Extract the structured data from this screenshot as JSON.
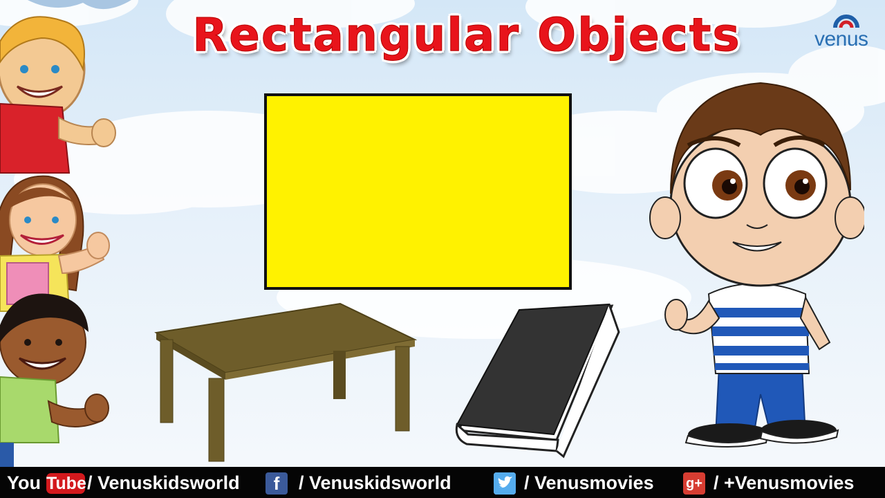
{
  "title": "Rectangular Objects",
  "brand": {
    "name": "venus"
  },
  "footer": {
    "youtube_you": "You",
    "youtube_tube": "Tube",
    "youtube_handle": "/ Venuskidsworld",
    "facebook_handle": "/ Venuskidsworld",
    "twitter_handle": "/ Venusmovies",
    "gplus_handle": "/ +Venusmovies",
    "facebook_glyph": "f",
    "gplus_glyph": "g+"
  },
  "colors": {
    "title_red": "#e8141b",
    "rect_yellow": "#fff200",
    "table_brown": "#6e5d2a",
    "book_black": "#333333",
    "footer_black": "#050505",
    "facebook_blue": "#3b5a9a",
    "gplus_red": "#d73d32",
    "youtube_red": "#d3191d"
  },
  "icons": [
    "youtube-logo-icon",
    "facebook-icon",
    "twitter-icon",
    "google-plus-icon",
    "venus-logo-icon"
  ]
}
